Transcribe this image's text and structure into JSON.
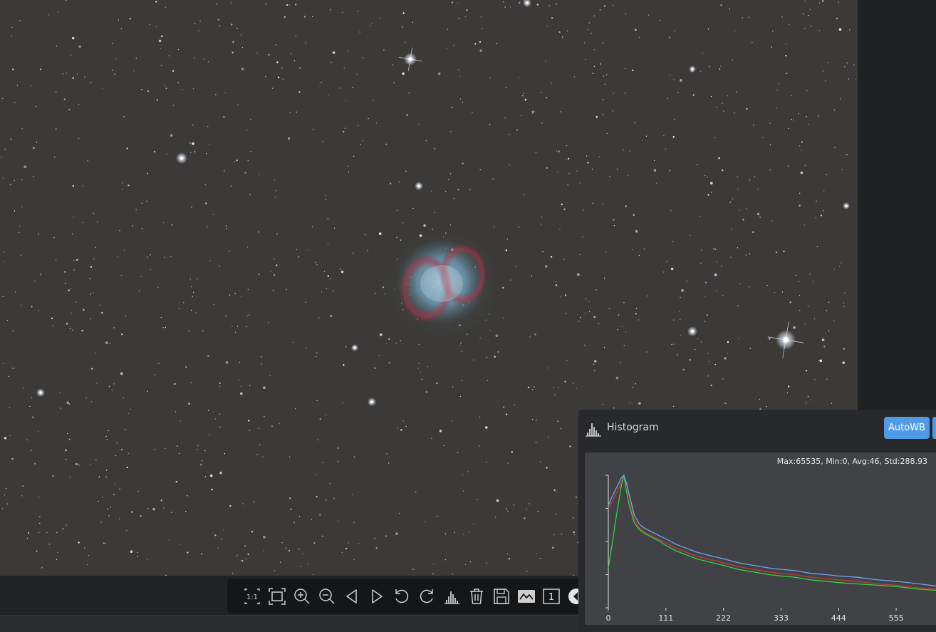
{
  "toolbar": {
    "buttons": [
      {
        "id": "zoom-1to1",
        "icon": "zoom-1-1-icon",
        "label": "1:1"
      },
      {
        "id": "fit-to-window",
        "icon": "fit-window-icon"
      },
      {
        "id": "zoom-in",
        "icon": "zoom-in-icon"
      },
      {
        "id": "zoom-out",
        "icon": "zoom-out-icon"
      },
      {
        "id": "previous-image",
        "icon": "previous-icon"
      },
      {
        "id": "next-image",
        "icon": "next-icon"
      },
      {
        "id": "rotate-left",
        "icon": "rotate-left-icon"
      },
      {
        "id": "rotate-right",
        "icon": "rotate-right-icon"
      },
      {
        "id": "histogram",
        "icon": "histogram-icon"
      },
      {
        "id": "delete",
        "icon": "trash-icon"
      },
      {
        "id": "save",
        "icon": "save-icon"
      },
      {
        "id": "stretch",
        "icon": "stretch-icon"
      },
      {
        "id": "single-view",
        "icon": "single-view-icon",
        "label": "1"
      },
      {
        "id": "collapse",
        "icon": "collapse-left-icon"
      }
    ]
  },
  "histogram": {
    "title": "Histogram",
    "autowb_label": "AutoWB",
    "stats": "Max:65535, Min:0, Avg:46, Std:288.93",
    "x_ticks": [
      "0",
      "111",
      "222",
      "333",
      "444",
      "555"
    ],
    "colors": {
      "red": "#c43a3a",
      "green": "#34d33a",
      "blue": "#6fa3ef",
      "accent": "#4f9be8"
    }
  },
  "chart_data": {
    "type": "line",
    "x": [
      0,
      5,
      10,
      15,
      20,
      25,
      30,
      35,
      40,
      45,
      50,
      60,
      70,
      80,
      90,
      100,
      111,
      130,
      150,
      170,
      190,
      222,
      250,
      280,
      310,
      333,
      360,
      390,
      420,
      444,
      480,
      520,
      555,
      600,
      640
    ],
    "xlim": [
      0,
      640
    ],
    "ylim": [
      0,
      1
    ],
    "x_ticks": [
      0,
      111,
      222,
      333,
      444,
      555
    ],
    "series": [
      {
        "values": [
          0.75,
          0.78,
          0.82,
          0.86,
          0.9,
          0.95,
          1.0,
          0.93,
          0.84,
          0.75,
          0.67,
          0.6,
          0.57,
          0.55,
          0.53,
          0.51,
          0.49,
          0.45,
          0.42,
          0.39,
          0.37,
          0.34,
          0.31,
          0.29,
          0.27,
          0.26,
          0.25,
          0.23,
          0.22,
          0.21,
          0.2,
          0.18,
          0.17,
          0.15,
          0.14
        ]
      },
      {
        "values": [
          0.3,
          0.42,
          0.55,
          0.68,
          0.8,
          0.92,
          1.0,
          0.88,
          0.78,
          0.71,
          0.64,
          0.59,
          0.56,
          0.54,
          0.52,
          0.5,
          0.47,
          0.43,
          0.4,
          0.37,
          0.35,
          0.32,
          0.29,
          0.27,
          0.25,
          0.24,
          0.23,
          0.21,
          0.2,
          0.19,
          0.18,
          0.17,
          0.16,
          0.14,
          0.13
        ]
      },
      {
        "values": [
          0.77,
          0.82,
          0.86,
          0.9,
          0.94,
          0.98,
          1.0,
          0.94,
          0.86,
          0.78,
          0.7,
          0.63,
          0.6,
          0.58,
          0.56,
          0.54,
          0.52,
          0.48,
          0.45,
          0.42,
          0.4,
          0.37,
          0.34,
          0.32,
          0.3,
          0.29,
          0.28,
          0.26,
          0.25,
          0.24,
          0.23,
          0.21,
          0.2,
          0.18,
          0.16
        ]
      }
    ]
  }
}
